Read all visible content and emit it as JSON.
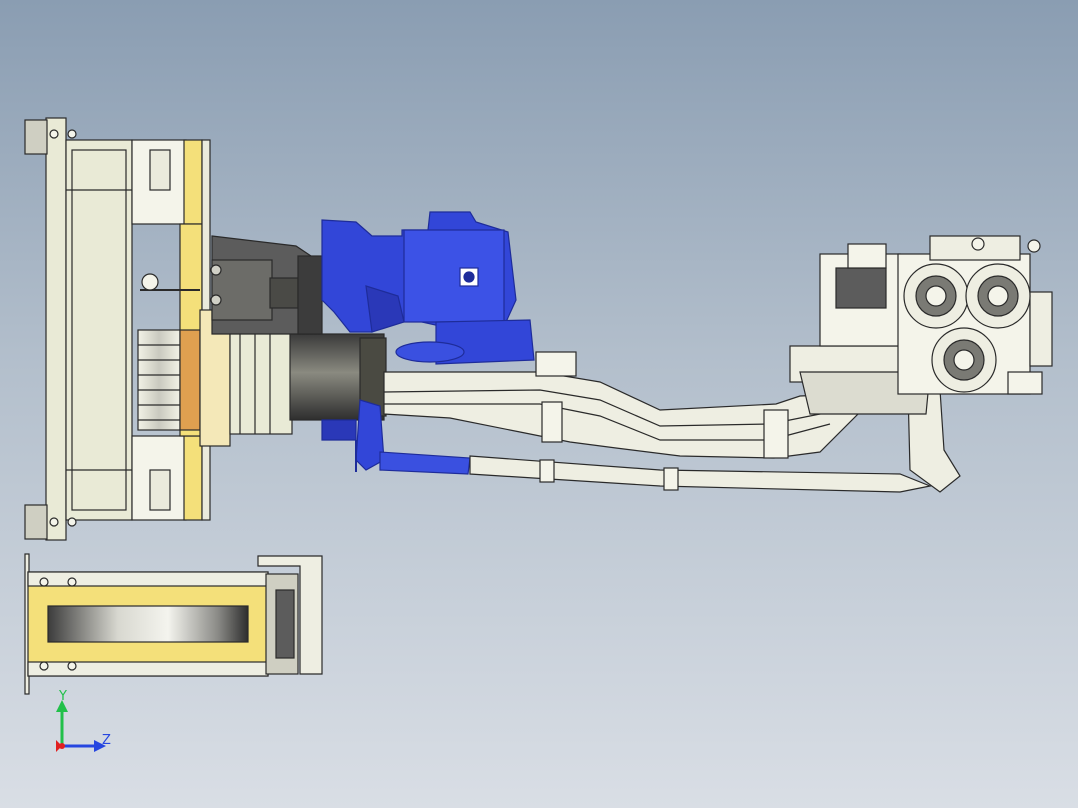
{
  "viewport": {
    "background_top": "#8a9db2",
    "background_bottom": "#d9dee5"
  },
  "triad": {
    "y_label": "Y",
    "z_label": "Z",
    "y_color": "#22c04a",
    "z_color": "#2646e0",
    "x_color": "#e02020"
  },
  "colors": {
    "frame": "#e9ead6",
    "outline": "#2a2a2a",
    "yellow": "#f4e07a",
    "blue": "#3246d8",
    "dark_blue": "#1e2c9a",
    "gray": "#5c5c5c",
    "dark_gray": "#3c3c3c",
    "hose": "#eeeee2",
    "orange": "#e0a050"
  }
}
